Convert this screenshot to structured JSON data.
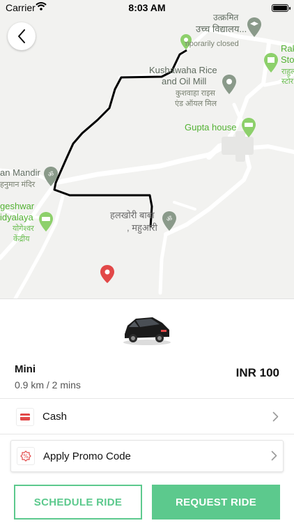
{
  "status_bar": {
    "carrier": "Carrier",
    "time": "8:03 AM"
  },
  "map": {
    "labels": {
      "school_hi": "उत्क्रमित",
      "school_hi2": "उच्च विद्यालय...",
      "temporarily_closed": "Temporarily closed",
      "rice_mill": "Kushawaha Rice",
      "rice_mill2": "and Oil Mill",
      "rice_mill_hi": "कुशवाहा राइस",
      "rice_mill_hi2": "एंड ऑयल मिल",
      "gupta_house": "Gupta house",
      "rak": "Rak",
      "sto": "Sto",
      "rahul_hi": "राहुल",
      "store_hi": "स्टोर",
      "hanuman": "an Mandir",
      "hanuman_hi": "हनुमान मंदिर",
      "yogeshwar": "geshwar",
      "yogeshwar2": "idyalaya",
      "yogeshwar_hi": "योगेश्वर",
      "yogeshwar_hi2": "केंद्रीय",
      "halkhori": "हलखोरी बाबा",
      "halkhori2": ", महुआरी"
    }
  },
  "ride": {
    "name": "Mini",
    "info": "0.9 km / 2 mins",
    "price": "INR 100"
  },
  "payment": {
    "label": "Cash"
  },
  "promo": {
    "label": "Apply Promo Code"
  },
  "buttons": {
    "schedule": "SCHEDULE RIDE",
    "request": "REQUEST RIDE"
  },
  "colors": {
    "accent": "#5cc98d",
    "route": "#000000",
    "destination_pin": "#e24848",
    "poi_green": "#8dd06b"
  }
}
